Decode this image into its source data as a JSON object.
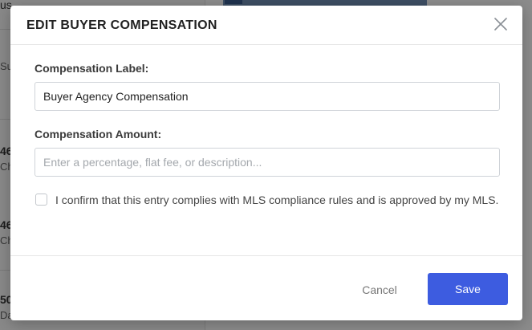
{
  "modal": {
    "title": "EDIT BUYER COMPENSATION",
    "fields": {
      "label": {
        "label": "Compensation Label:",
        "value": "Buyer Agency Compensation"
      },
      "amount": {
        "label": "Compensation Amount:",
        "value": "",
        "placeholder": "Enter a percentage, flat fee, or description..."
      }
    },
    "confirm_text": "I confirm that this entry complies with MLS compliance rules and is approved by my MLS.",
    "cancel_label": "Cancel",
    "save_label": "Save"
  },
  "background": {
    "fragments": [
      "us",
      "Su",
      "46",
      "Ch",
      "46",
      "Ch",
      "50",
      "Da"
    ]
  },
  "colors": {
    "primary": "#3d5ce0",
    "title_text": "#222222",
    "muted_text": "#777777"
  }
}
